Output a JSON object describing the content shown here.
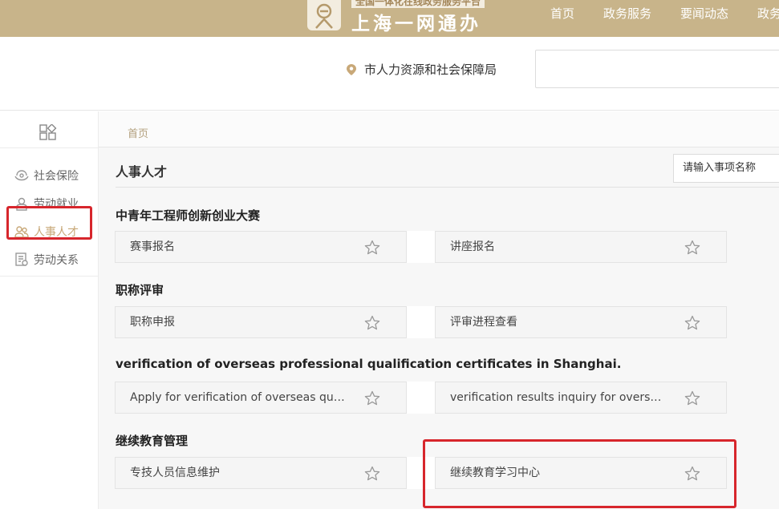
{
  "header": {
    "logo_sub": "全国一体化在线政务服务平台",
    "logo_main": "上海一网通办",
    "nav": [
      "首页",
      "政务服务",
      "要闻动态",
      "政务"
    ]
  },
  "subbar": {
    "location": "市人力资源和社会保障局"
  },
  "sidebar": {
    "items": [
      {
        "label": "社会保险",
        "icon": "umbrella-hands-icon"
      },
      {
        "label": "劳动就业",
        "icon": "worker-icon"
      },
      {
        "label": "人事人才",
        "icon": "people-icon",
        "active": true
      },
      {
        "label": "劳动关系",
        "icon": "document-icon"
      }
    ]
  },
  "breadcrumb": {
    "home": "首页"
  },
  "main": {
    "category_title": "人事人才",
    "search_placeholder": "请输入事项名称",
    "sections": [
      {
        "title": "中青年工程师创新创业大赛",
        "items": [
          "赛事报名",
          "讲座报名"
        ]
      },
      {
        "title": "职称评审",
        "items": [
          "职称申报",
          "评审进程查看"
        ]
      },
      {
        "title": "verification of overseas professional qualification certificates in Shanghai.",
        "items": [
          "Apply for verification of overseas qualification certificates",
          "verification results inquiry for overseas certificates"
        ]
      },
      {
        "title": "继续教育管理",
        "items": [
          "专技人员信息维护",
          "继续教育学习中心"
        ]
      }
    ]
  },
  "colors": {
    "brand": "#c8b48a",
    "highlight": "#d7262c",
    "active_text": "#c8a878"
  }
}
